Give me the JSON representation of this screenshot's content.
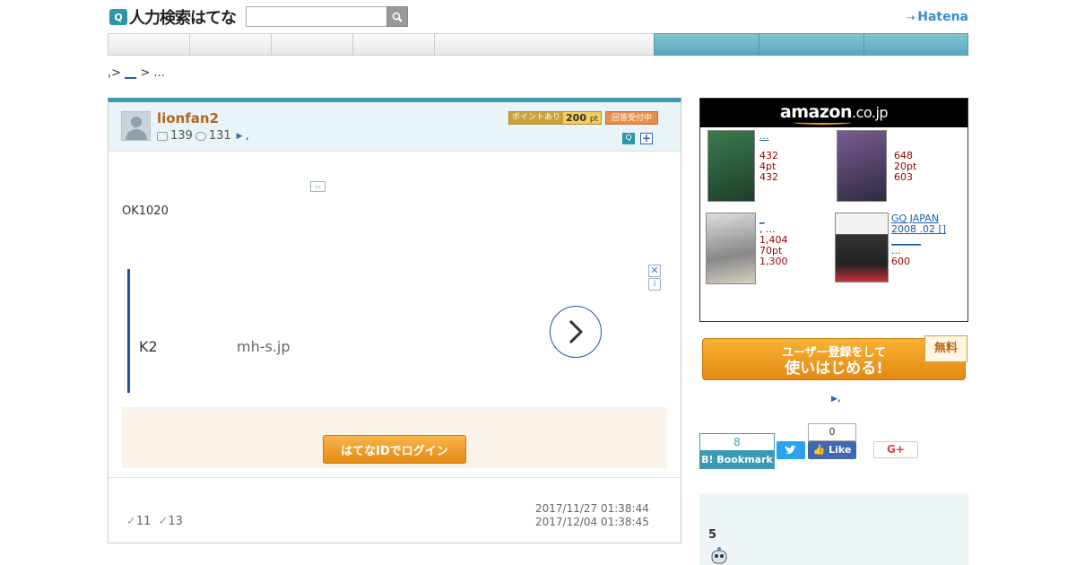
{
  "header": {
    "logo_icon": "Q",
    "logo_text": "人力検索はてな",
    "search_placeholder": "",
    "hatena_logo": "Hatena"
  },
  "breadcrumb": {
    "sep1": ",>",
    "link": "__",
    "sep2": ">",
    "ellipsis": "..."
  },
  "question": {
    "username": "lionfan2",
    "questions_count": "139",
    "answers_count": "131",
    "stats_suffix": ",",
    "point_label": "ポイントあり",
    "point_value": "200",
    "point_unit": "pt",
    "status": "回答受付中",
    "body": "OK1020",
    "checks_1": "11",
    "checks_2": "13",
    "date_posted": "2017/11/27 01:38:44",
    "date_closes": "2017/12/04 01:38:45"
  },
  "ad": {
    "title": "K2",
    "domain": "mh-s.jp",
    "close": "✕",
    "info": "i"
  },
  "login": {
    "button": "はてなIDでログイン"
  },
  "amazon": {
    "brand": "amazon",
    "domain": ".co.jp",
    "items": [
      {
        "title": "...",
        "price": "432",
        "points": "4pt",
        "used": "432",
        "cover_color": "#2c5d3a"
      },
      {
        "title": "",
        "price": "648",
        "points": "20pt",
        "used": "603",
        "cover_color": "#5a3f6e"
      },
      {
        "title": "_",
        "author": ", ...",
        "price": "1,404",
        "points": "70pt",
        "used": "1,300",
        "cover_color": "#6a7078"
      },
      {
        "title": "GQ JAPAN 2008 .02 [] ______",
        "author": "...",
        "price": "600",
        "cover_color": "#c8303a"
      }
    ]
  },
  "register": {
    "line1": "ユーザー登録をして",
    "line2": "使いはじめる!",
    "free": "無料",
    "link_text": ","
  },
  "social": {
    "hatebu_count": "8",
    "hatebu_label": "B! Bookmark",
    "tweet_label": "t",
    "fb_count": "0",
    "fb_label": "Like",
    "gplus_label": "G+"
  },
  "answers": {
    "count": "5"
  },
  "colors": {
    "accent": "#3a9ab4",
    "nav_blue": "#6fb6c8",
    "orange": "#e98e26",
    "link": "#1a5ea8"
  }
}
